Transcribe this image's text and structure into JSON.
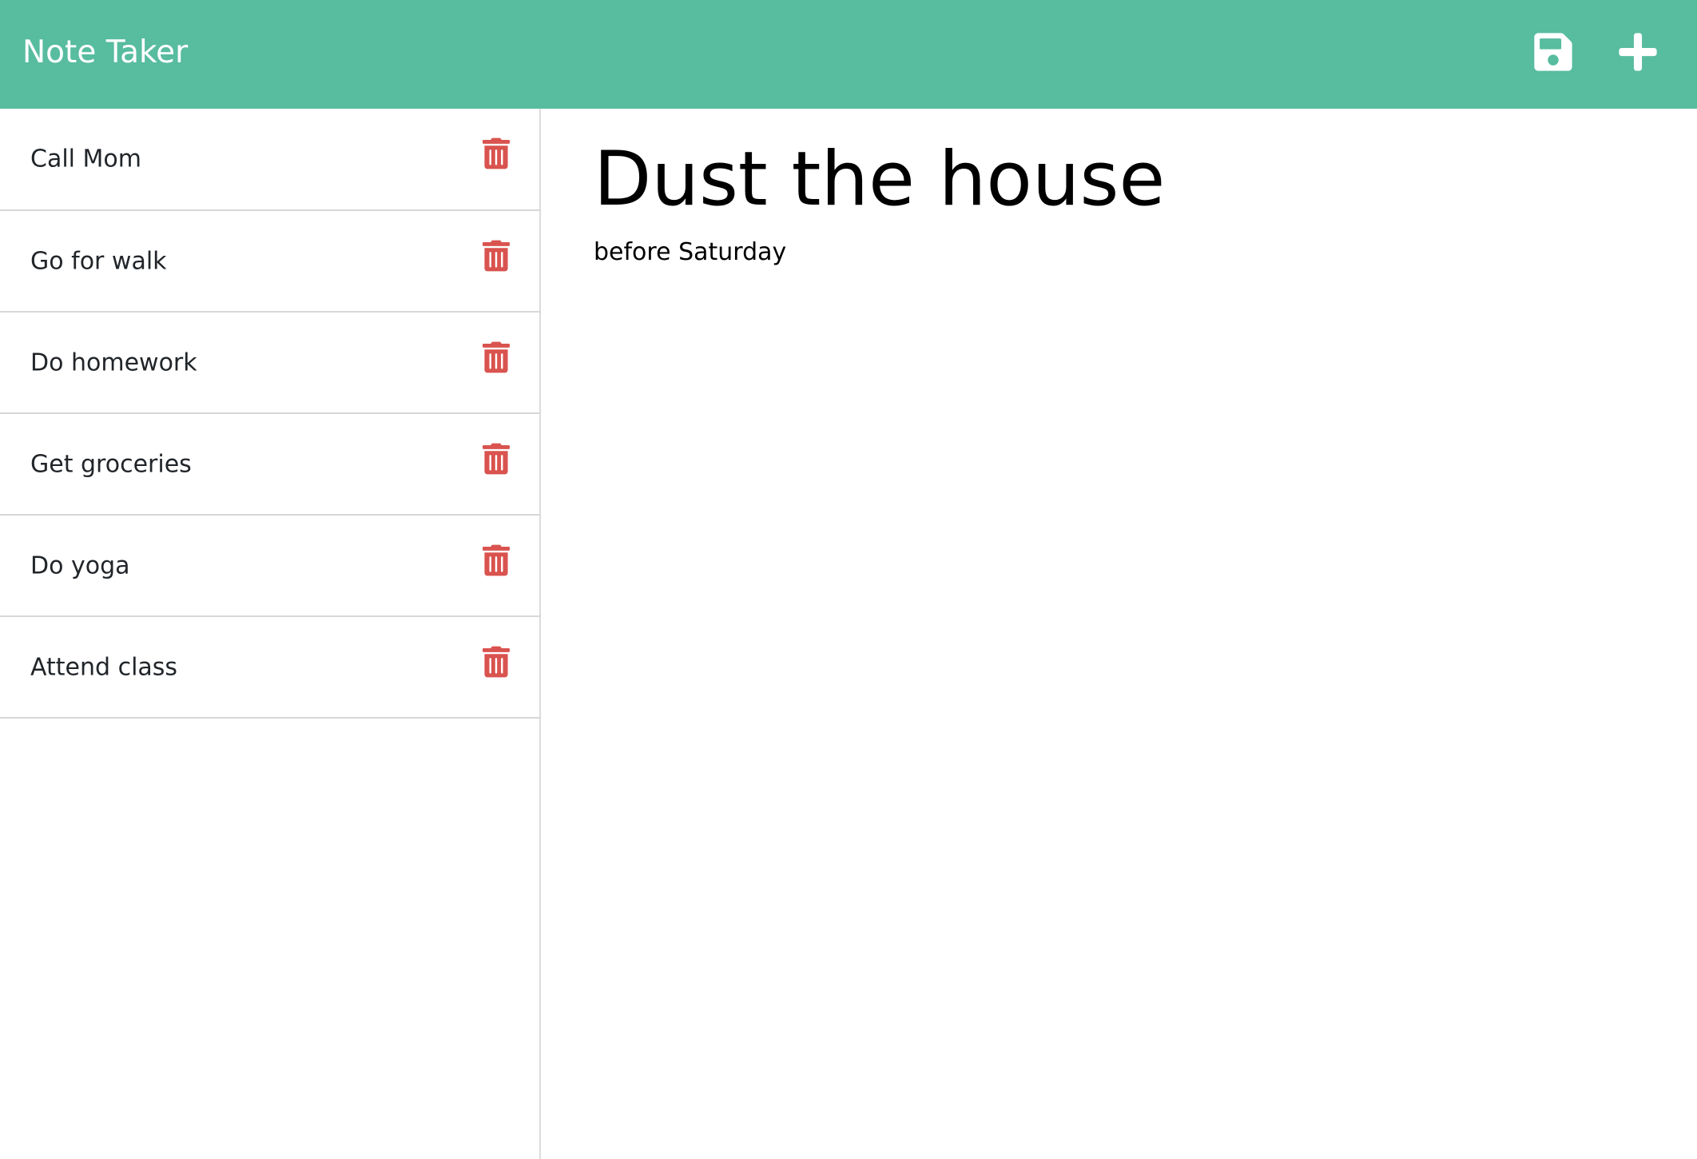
{
  "navbar": {
    "brand": "Note Taker",
    "background_color": "#58bc9f",
    "save_icon": "floppy-disk-icon",
    "new_icon": "plus-icon"
  },
  "sidebar": {
    "delete_icon": "trash-icon",
    "delete_color": "#d9534f",
    "notes": [
      {
        "title": "Call Mom"
      },
      {
        "title": "Go for walk"
      },
      {
        "title": "Do homework"
      },
      {
        "title": "Get groceries"
      },
      {
        "title": "Do yoga"
      },
      {
        "title": "Attend class"
      }
    ]
  },
  "editor": {
    "title_value": "Dust the house",
    "body_value": "before Saturday"
  }
}
